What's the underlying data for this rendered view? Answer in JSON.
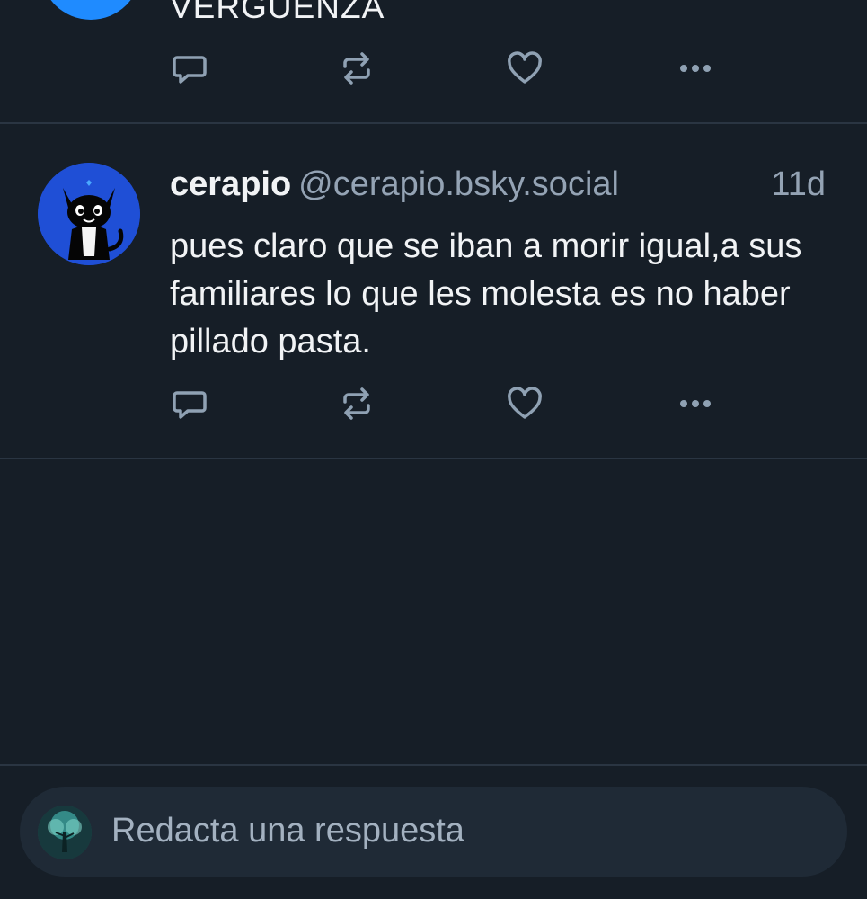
{
  "previous_post": {
    "text": "VERGÜENZA"
  },
  "post": {
    "author_name": "cerapio",
    "author_handle": "@cerapio.bsky.social",
    "time": "11d",
    "text": "pues claro que se iban a morir igual,a sus familiares lo que les molesta es no haber pillado pasta."
  },
  "actions": {
    "icons": [
      "reply-icon",
      "repost-icon",
      "like-icon",
      "more-icon"
    ]
  },
  "composer": {
    "placeholder": "Redacta una respuesta"
  },
  "colors": {
    "background": "#161e27",
    "divider": "#2a3542",
    "icon": "#8fa1b3",
    "muted_text": "#94a3b4",
    "composer_bg": "#1f2a36",
    "avatar_blue": "#1f4fd6"
  }
}
